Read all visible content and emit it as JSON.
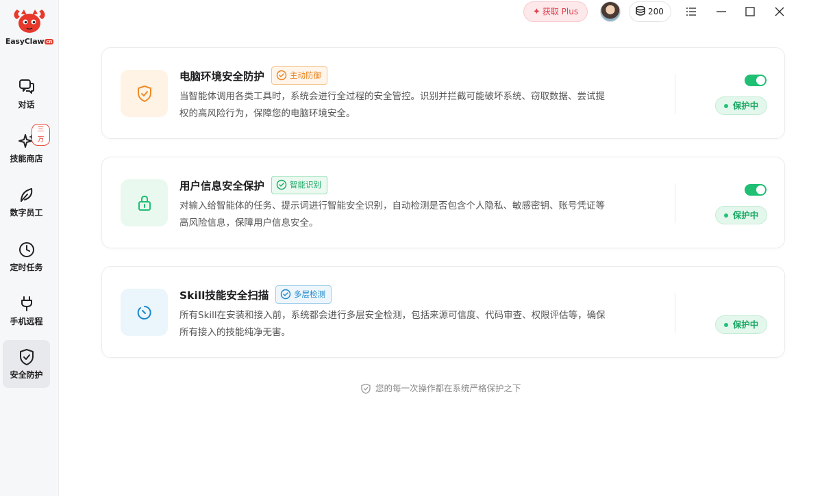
{
  "sidebar": {
    "logo_text": "EasyClaw",
    "logo_badge": "cn",
    "items": [
      {
        "label": "对话",
        "icon": "chat-icon"
      },
      {
        "label": "技能商店",
        "icon": "sparkle-icon",
        "badge": "三万"
      },
      {
        "label": "数字员工",
        "icon": "leaf-icon"
      },
      {
        "label": "定时任务",
        "icon": "clock-icon"
      },
      {
        "label": "手机远程",
        "icon": "plug-icon"
      },
      {
        "label": "安全防护",
        "icon": "shield-check-icon",
        "active": true
      }
    ]
  },
  "topbar": {
    "plus_label": "获取 Plus",
    "coins": "200"
  },
  "cards": [
    {
      "title": "电脑环境安全防护",
      "tag": "主动防御",
      "desc_line1": "当智能体调用各类工具时，系统会进行全过程的安全管控。识别并拦截可能破坏系统、窃取数据、尝试提",
      "desc_line2": "权的高风险行为，保障您的电脑环境安全。",
      "toggle_on": true,
      "status": "保护中",
      "icon": "shield-check-icon"
    },
    {
      "title": "用户信息安全保护",
      "tag": "智能识别",
      "desc_line1": "对输入给智能体的任务、提示词进行智能安全识别，自动检测是否包含个人隐私、敏感密钥、账号凭证等",
      "desc_line2": "高风险信息，保障用户信息安全。",
      "toggle_on": true,
      "status": "保护中",
      "icon": "lock-icon"
    },
    {
      "title": "Skill技能安全扫描",
      "tag": "多层检测",
      "desc_line1": "所有Skill在安装和接入前，系统都会进行多层安全检测，包括来源可信度、代码审查、权限评估等，确保",
      "desc_line2": "所有接入的技能纯净无害。",
      "status": "保护中",
      "icon": "scan-icon"
    }
  ],
  "footer_note": "您的每一次操作都在系统严格保护之下",
  "colors": {
    "accent_green": "#1fbf74",
    "orange": "#f08a24",
    "blue": "#1a86c8",
    "plus_red": "#e0424e"
  }
}
